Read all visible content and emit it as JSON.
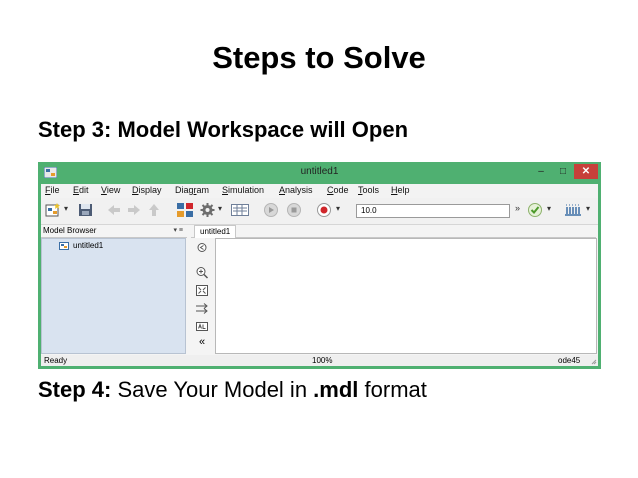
{
  "slide": {
    "title": "Steps to Solve",
    "step3": "Step 3: Model Workspace will Open",
    "step4_prefix": "Step 4:",
    "step4_text_a": " Save Your Model in ",
    "step4_format": ".mdl",
    "step4_text_b": " format"
  },
  "window": {
    "title": "untitled1",
    "min_glyph": "–",
    "max_glyph": "□",
    "close_glyph": "✕",
    "frame_color": "#4fb071"
  },
  "menu": {
    "file": {
      "u": "F",
      "rest": "ile"
    },
    "edit": {
      "u": "E",
      "rest": "dit"
    },
    "view": {
      "u": "V",
      "rest": "iew"
    },
    "display": {
      "u": "D",
      "rest": "isplay"
    },
    "diagram": {
      "pre": "Diag",
      "u": "r",
      "rest": "am"
    },
    "simulation": {
      "u": "S",
      "rest": "imulation"
    },
    "analysis": {
      "u": "A",
      "rest": "nalysis"
    },
    "code": {
      "u": "C",
      "rest": "ode"
    },
    "tools": {
      "u": "T",
      "rest": "ools"
    },
    "help": {
      "u": "H",
      "rest": "elp"
    }
  },
  "toolbar": {
    "stop_time": "10.0",
    "more_glyph": "»",
    "drop_glyph": "▾"
  },
  "model_browser": {
    "label": "Model Browser",
    "controls": "▾ ≡",
    "tree_item": "untitled1"
  },
  "editor": {
    "tab_label": "untitled1",
    "hide_glyph": "«"
  },
  "status": {
    "ready": "Ready",
    "zoom": "100%",
    "solver": "ode45"
  },
  "colors": {
    "record": "#d0262b",
    "check": "#4c9a2a",
    "close_button": "#c7403a"
  },
  "icons": [
    "app-icon",
    "new-model-icon",
    "save-icon",
    "back-icon",
    "forward-icon",
    "up-icon",
    "library-browser-icon",
    "gear-icon",
    "model-explorer-icon",
    "play-icon",
    "stop-icon",
    "record-icon",
    "check-icon",
    "signal-builder-icon",
    "hide-browser-icon",
    "zoom-icon",
    "fit-view-icon",
    "route-icon",
    "text-icon"
  ]
}
